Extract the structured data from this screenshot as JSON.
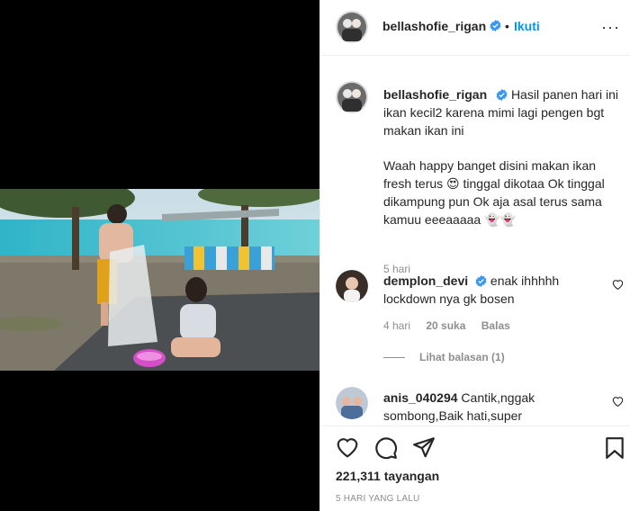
{
  "post": {
    "username": "bellashofie_rigan",
    "follow_label": "Ikuti",
    "dot": "•",
    "more_label": "···"
  },
  "caption": {
    "username": "bellashofie_rigan",
    "text_1": "Hasil panen hari ini ikan kecil2 karena mimi lagi pengen bgt makan ikan ini",
    "text_2": "Waah happy banget disini makan ikan fresh terus 😍 tinggal dikotaa Ok tinggal dikampung pun Ok aja asal terus sama kamuu eeeaaaaa 👻👻",
    "time": "5 hari"
  },
  "comments": [
    {
      "username": "demplon_devi",
      "verified": true,
      "text": "enak ihhhhh lockdown nya gk bosen",
      "time": "4 hari",
      "likes": "20 suka",
      "reply_label": "Balas",
      "view_replies": "Lihat balasan (1)"
    },
    {
      "username": "anis_040294",
      "verified": false,
      "text": "Cantik,nggak sombong,Baik hati,super"
    }
  ],
  "actions": {
    "icons": [
      "heart-icon",
      "comment-icon",
      "share-icon",
      "bookmark-icon"
    ],
    "views_count": "221,311",
    "views_label": "tayangan",
    "date": "5 HARI YANG LALU"
  },
  "colors": {
    "link_blue": "#0095f6",
    "verified_blue": "#3897f0",
    "muted": "#8e8e8e",
    "text": "#262626"
  }
}
